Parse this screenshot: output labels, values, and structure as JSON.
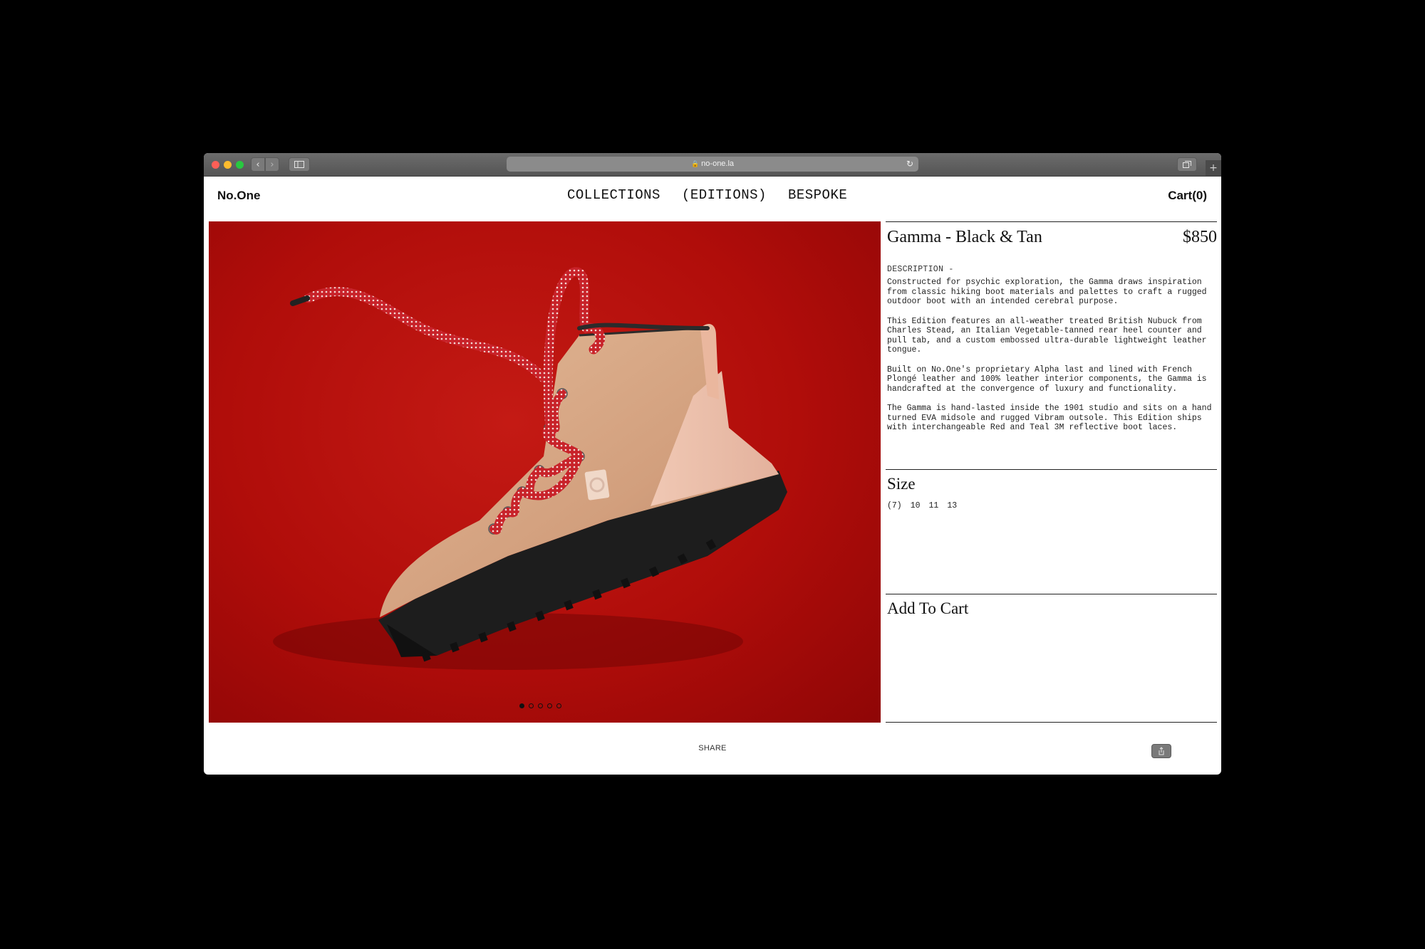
{
  "browser": {
    "url": "no-one.la"
  },
  "site": {
    "logo": "No.One",
    "nav": [
      "COLLECTIONS",
      "(EDITIONS)",
      "BESPOKE"
    ],
    "cart": "Cart(0)"
  },
  "product": {
    "title": "Gamma - Black & Tan",
    "price": "$850",
    "description_label": "DESCRIPTION -",
    "description": [
      "Constructed for psychic exploration, the Gamma draws inspiration from classic hiking boot materials and palettes to craft a rugged outdoor boot with an intended cerebral purpose.",
      "This Edition features an all-weather treated British Nubuck from Charles Stead, an Italian Vegetable-tanned rear heel counter and pull tab, and a custom embossed ultra-durable lightweight leather tongue.",
      "Built on No.One's proprietary Alpha last and lined with French Plongé leather and 100% leather interior components, the Gamma is handcrafted at the convergence of luxury and functionality.",
      "The Gamma is hand-lasted inside the 1901 studio and sits on a hand turned EVA midsole and rugged Vibram outsole. This Edition ships with interchangeable Red and Teal 3M reflective boot laces."
    ],
    "size_title": "Size",
    "sizes": [
      "(7)",
      "10",
      "11",
      "13"
    ],
    "add_to_cart": "Add To Cart"
  },
  "gallery": {
    "slide_count": 5,
    "active_index": 0
  },
  "footer": {
    "share": "SHARE"
  },
  "colors": {
    "hero_background": "#b00d0a",
    "laces": "#c8232a",
    "boot_nubuck": "#d5a583",
    "sole": "#1f1f1f"
  }
}
